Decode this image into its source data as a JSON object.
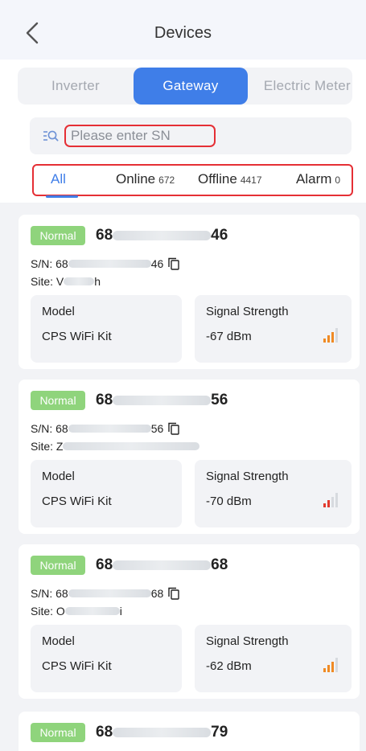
{
  "header": {
    "title": "Devices"
  },
  "tabs": [
    {
      "label": "Inverter",
      "active": false
    },
    {
      "label": "Gateway",
      "active": true
    },
    {
      "label": "Electric Meter",
      "active": false
    }
  ],
  "search": {
    "placeholder": "Please enter SN",
    "icon": "search-list-icon"
  },
  "filters": [
    {
      "label": "All",
      "count": ""
    },
    {
      "label": "Online",
      "count": "672"
    },
    {
      "label": "Offline",
      "count": "4417"
    },
    {
      "label": "Alarm",
      "count": "0"
    }
  ],
  "colors": {
    "accent": "#3f7ee8",
    "normal_badge": "#8fd47c",
    "highlight": "#e52f35"
  },
  "devices": [
    {
      "status": "Normal",
      "title_prefix": "68",
      "title_suffix": "46",
      "sn_prefix": "S/N: 68",
      "sn_suffix": "46",
      "site_prefix": "Site: V",
      "site_suffix": "h",
      "model_label": "Model",
      "model": "CPS WiFi Kit",
      "signal_label": "Signal Strength",
      "signal": "-67 dBm",
      "signal_bars": 3
    },
    {
      "status": "Normal",
      "title_prefix": "68",
      "title_suffix": "56",
      "sn_prefix": "S/N: 68",
      "sn_suffix": "56",
      "site_prefix": "Site: Z",
      "site_suffix": "",
      "model_label": "Model",
      "model": "CPS WiFi Kit",
      "signal_label": "Signal Strength",
      "signal": "-70 dBm",
      "signal_bars": 2
    },
    {
      "status": "Normal",
      "title_prefix": "68",
      "title_suffix": "68",
      "sn_prefix": "S/N: 68",
      "sn_suffix": "68",
      "site_prefix": "Site: O",
      "site_suffix": "i",
      "model_label": "Model",
      "model": "CPS WiFi Kit",
      "signal_label": "Signal Strength",
      "signal": "-62 dBm",
      "signal_bars": 3
    },
    {
      "status": "Normal",
      "title_prefix": "68",
      "title_suffix": "79"
    }
  ]
}
